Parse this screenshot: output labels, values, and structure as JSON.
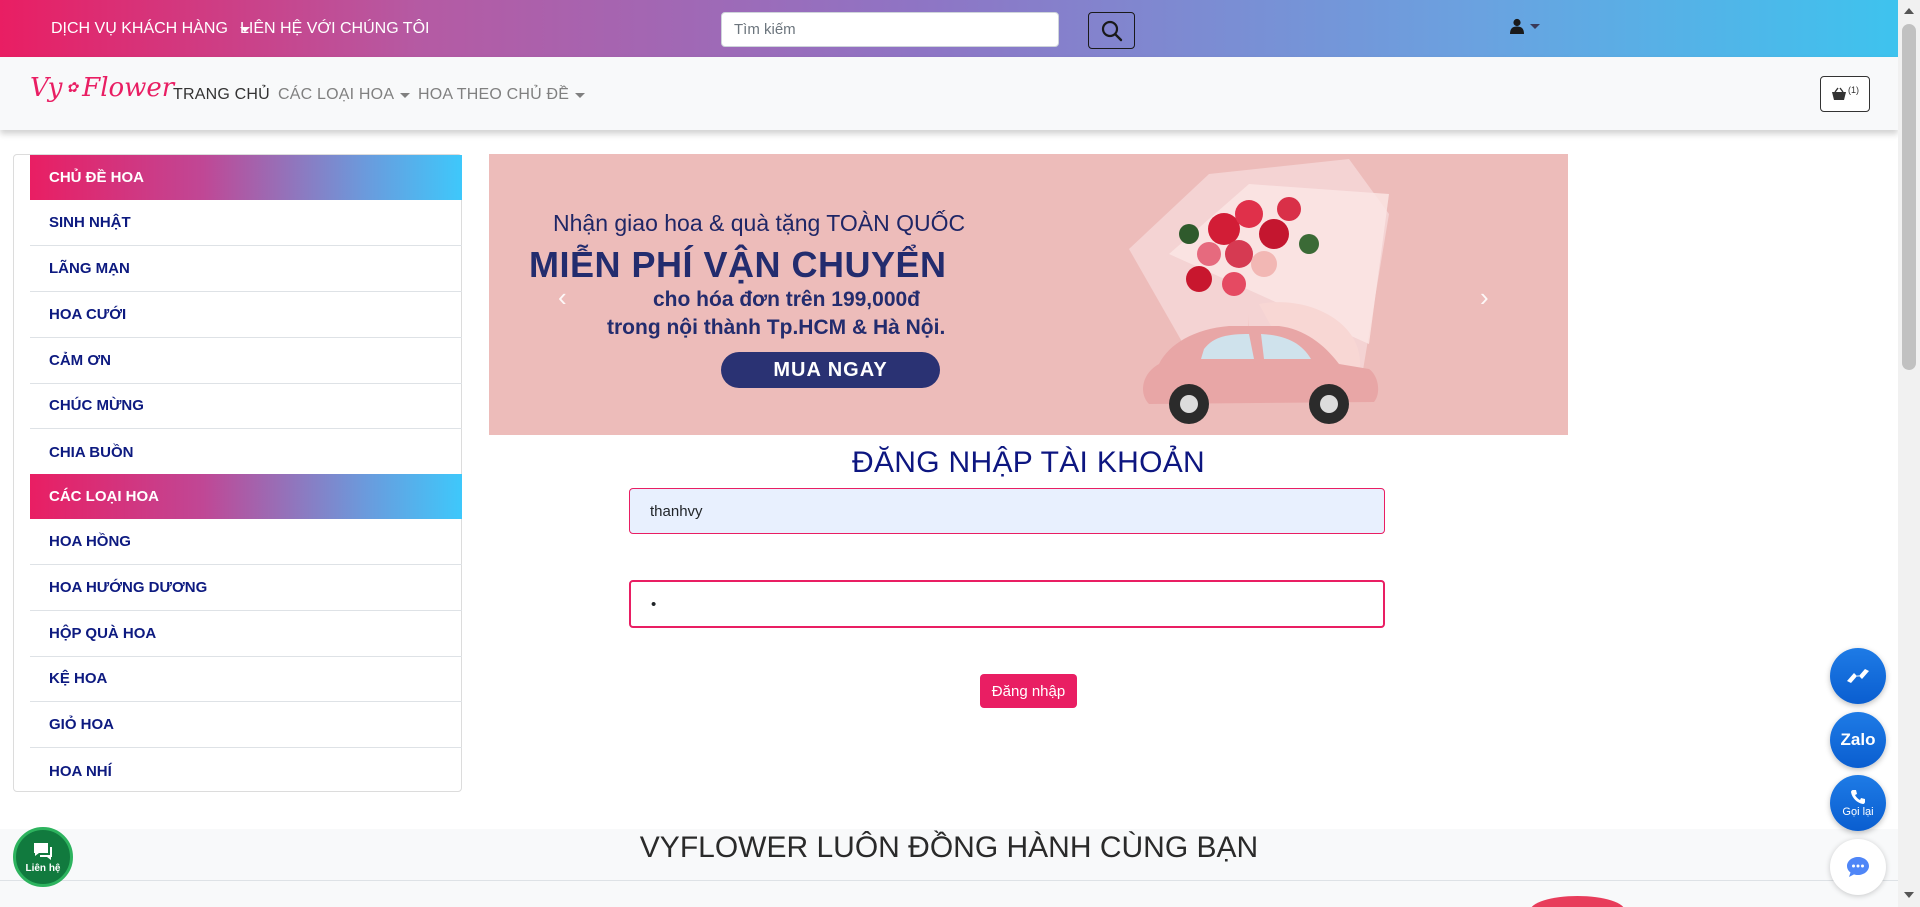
{
  "topbar": {
    "customer_service": "DỊCH VỤ KHÁCH HÀNG",
    "contact_us": "LIÊN HỆ VỚI CHÚNG TÔI",
    "search_placeholder": "Tìm kiếm",
    "search_icon": "magnifier-icon",
    "user_icon": "user-icon"
  },
  "navbar": {
    "brand_left": "Vy",
    "brand_right": "Flower",
    "home": "TRANG CHỦ",
    "flower_types": "CÁC LOẠI HOA",
    "flowers_by_theme": "HOA THEO CHỦ ĐỀ",
    "cart_count": "(1)",
    "cart_icon": "basket-icon"
  },
  "sidebar": {
    "themes_header": "CHỦ ĐỀ HOA",
    "themes": [
      "SINH NHẬT",
      "LÃNG MẠN",
      "HOA CƯỚI",
      "CẢM ƠN",
      "CHÚC MỪNG",
      "CHIA BUỒN"
    ],
    "types_header": "CÁC LOẠI HOA",
    "types": [
      "HOA HỒNG",
      "HOA HƯỚNG DƯƠNG",
      "HỘP QUÀ HOA",
      "KỆ HOA",
      "GIỎ HOA",
      "HOA NHÍ"
    ]
  },
  "banner": {
    "line1": "Nhận giao hoa & quà tặng TOÀN QUỐC",
    "line2": "MIỄN PHÍ VẬN CHUYỂN",
    "line3": "cho hóa đơn trên 199,000đ",
    "line4": "trong nội thành Tp.HCM & Hà Nội.",
    "cta": "MUA NGAY",
    "colors": {
      "background": "#edbcba",
      "text": "#232c6e"
    }
  },
  "login": {
    "title": "ĐĂNG NHẬP TÀI KHOẢN",
    "username_value": "thanhvy",
    "password_value": "•",
    "button": "Đăng nhập"
  },
  "section": {
    "title": "VYFLOWER LUÔN ĐỒNG HÀNH CÙNG BẠN"
  },
  "floating": {
    "zalo": "Zalo",
    "callback": "Gọi lại",
    "contact": "Liên hệ"
  },
  "colors": {
    "accent": "#e91e63",
    "navy": "#0d1680",
    "gradient_end": "#3ec3ee"
  }
}
